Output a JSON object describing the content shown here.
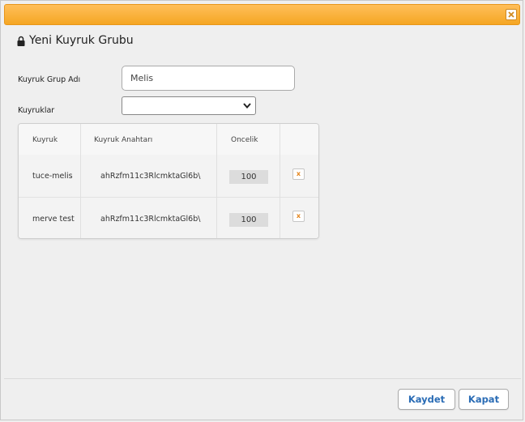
{
  "dialog": {
    "title": "Yeni Kuyruk Grubu",
    "accent_color": "#f5a623"
  },
  "form": {
    "group_name_label": "Kuyruk Grup Adı",
    "group_name_value": "Melis",
    "queues_label": "Kuyruklar",
    "queues_selected": ""
  },
  "table": {
    "headers": [
      "Kuyruk",
      "Kuyruk Anahtarı",
      "Öncelik",
      ""
    ],
    "rows": [
      {
        "queue": "tuce-melis",
        "key": "ahRzfm11c3RlcmktaGl6b\\",
        "priority": "100",
        "delete_label": "x"
      },
      {
        "queue": "merve test",
        "key": "ahRzfm11c3RlcmktaGl6b\\",
        "priority": "100",
        "delete_label": "x"
      }
    ]
  },
  "buttons": {
    "save": "Kaydet",
    "close": "Kapat",
    "color": "#2a6cb5"
  }
}
